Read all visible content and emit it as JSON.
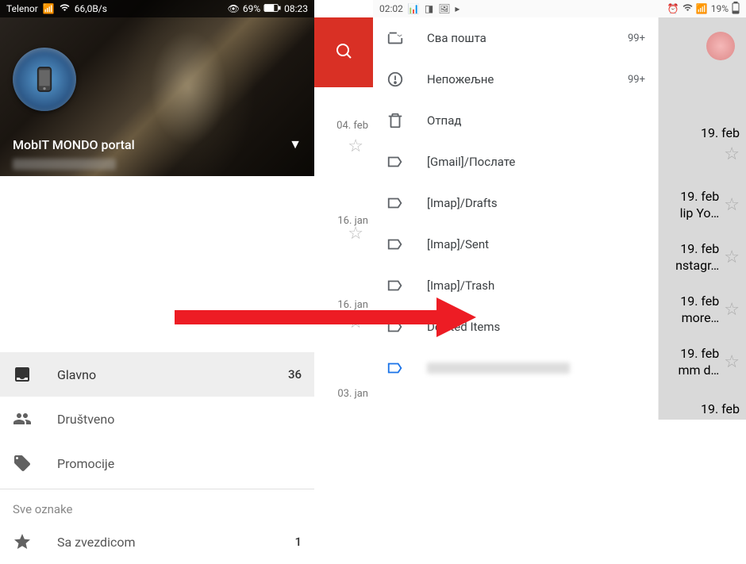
{
  "left": {
    "statusbar": {
      "carrier": "Telenor",
      "speed": "66,0B/s",
      "battery": "69%",
      "time": "08:23"
    },
    "account": {
      "name": "MobIT MONDO portal"
    },
    "drawer": {
      "items": [
        {
          "icon": "inbox",
          "label": "Glavno",
          "count": "36",
          "active": true
        },
        {
          "icon": "people",
          "label": "Društveno",
          "count": "",
          "active": false
        },
        {
          "icon": "tag",
          "label": "Promocije",
          "count": "",
          "active": false
        }
      ],
      "subheader": "Sve oznake",
      "starred": {
        "label": "Sa zvezdicom",
        "count": "1"
      }
    },
    "bg_rows": [
      {
        "date": "04. feb"
      },
      {
        "date": "16. jan"
      },
      {
        "date": "16. jan"
      },
      {
        "date": "03. jan"
      }
    ]
  },
  "right": {
    "statusbar": {
      "time": "02:02",
      "battery": "19%"
    },
    "drawer": {
      "items": [
        {
          "icon": "allmail",
          "label": "Сва пошта",
          "count": "99+"
        },
        {
          "icon": "spam",
          "label": "Непожељне",
          "count": "99+"
        },
        {
          "icon": "trash",
          "label": "Отпад",
          "count": ""
        },
        {
          "icon": "label",
          "label": "[Gmail]/Послате",
          "count": ""
        },
        {
          "icon": "label",
          "label": "[Imap]/Drafts",
          "count": ""
        },
        {
          "icon": "label",
          "label": "[Imap]/Sent",
          "count": ""
        },
        {
          "icon": "label",
          "label": "[Imap]/Trash",
          "count": ""
        },
        {
          "icon": "label",
          "label": "Deleted Items",
          "count": ""
        },
        {
          "icon": "label-current",
          "label": "",
          "count": "",
          "blurred": true
        }
      ]
    },
    "bg_rows": [
      {
        "date": "19. feb",
        "subj": ""
      },
      {
        "date": "19. feb",
        "subj": "lip Yo…"
      },
      {
        "date": "19. feb",
        "subj": "nstagr…"
      },
      {
        "date": "19. feb",
        "subj": "more…"
      },
      {
        "date": "19. feb",
        "subj": "mm d…"
      },
      {
        "date": "19. feb",
        "subj": ""
      }
    ]
  },
  "arrow_color": "#ed1c24"
}
